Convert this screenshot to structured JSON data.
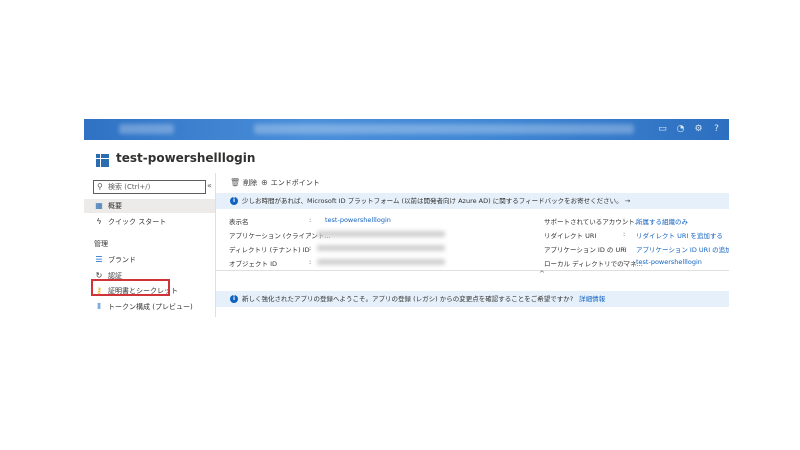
{
  "app": {
    "title": "test-powershelllogin"
  },
  "sidebar": {
    "search_placeholder": "検索 (Ctrl+/)",
    "collapse": "«",
    "items": [
      {
        "label": "概要",
        "icon": "grid-icon",
        "selected": true
      },
      {
        "label": "クイック スタート",
        "icon": "lightning-icon"
      }
    ],
    "section_title": "管理",
    "manage_items": [
      {
        "label": "ブランド",
        "icon": "brand-icon"
      },
      {
        "label": "認証",
        "icon": "auth-icon"
      },
      {
        "label": "証明書とシークレット",
        "icon": "key-icon",
        "highlighted": true
      },
      {
        "label": "トークン構成 (プレビュー)",
        "icon": "token-icon"
      }
    ]
  },
  "toolbar": {
    "delete_label": "削除",
    "endpoints_label": "エンドポイント"
  },
  "banner_top": {
    "text": "少しお時間があれば、Microsoft ID プラットフォーム (以前は開発者向け Azure AD) に関するフィードバックをお寄せください。",
    "arrow": "→"
  },
  "properties": {
    "left": [
      {
        "label": "表示名",
        "value": "test-powershelllogin"
      },
      {
        "label": "アプリケーション (クライアント...",
        "value": ""
      },
      {
        "label": "ディレクトリ (テナント) ID",
        "value": ""
      },
      {
        "label": "オブジェクト ID",
        "value": ""
      }
    ],
    "right": [
      {
        "label": "サポートされているアカウント...",
        "value": "所属する組織のみ"
      },
      {
        "label": "リダイレクト URI",
        "value": "リダイレクト URI を追加する"
      },
      {
        "label": "アプリケーション ID の URI",
        "value": "アプリケーション ID URI の追加"
      },
      {
        "label": "ローカル ディレクトリでのマネ...",
        "value": "test-powershelllogin"
      }
    ],
    "separator": ":",
    "collapse": "^"
  },
  "banner_bottom": {
    "text": "新しく強化されたアプリの登録へようこそ。アプリの登録 (レガシ) からの変更点を確認することをご希望ですか?",
    "link": "詳細情報"
  },
  "colors": {
    "accent": "#0f62c2",
    "topbar": "#3f86d4",
    "highlight": "#d13438",
    "banner": "#e6f0fa"
  }
}
